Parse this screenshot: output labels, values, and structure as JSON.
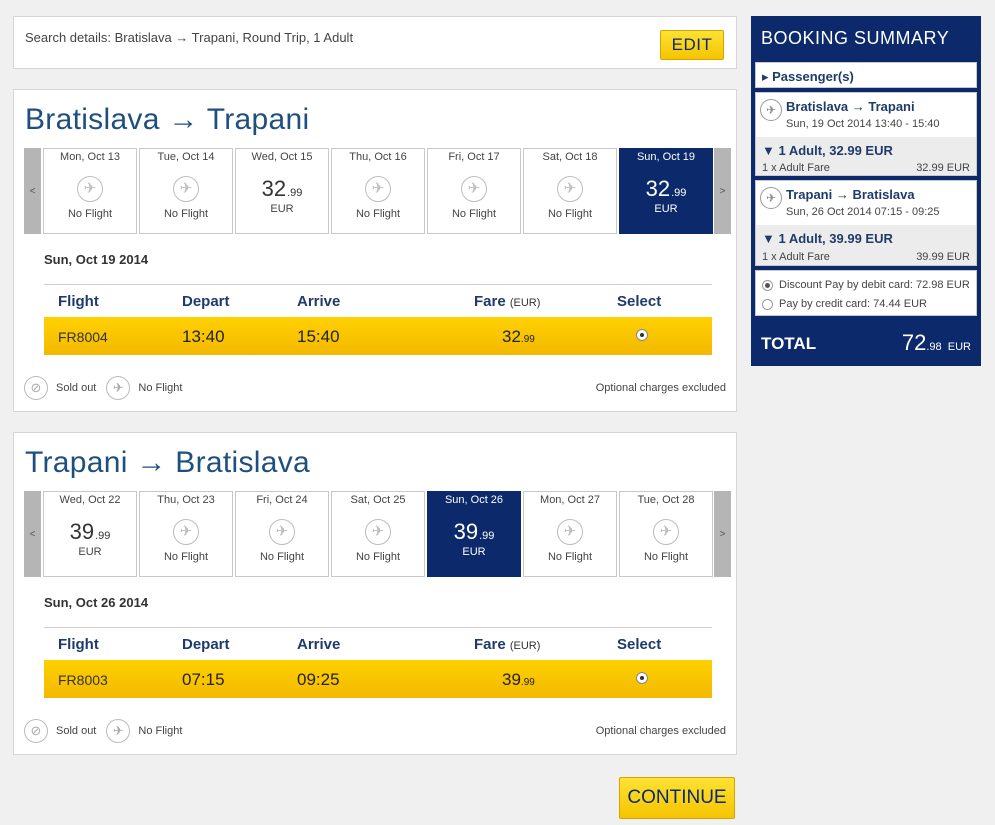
{
  "search": {
    "details": "Search details: Bratislava → Trapani, Round Trip, 1 Adult",
    "edit_label": "EDIT"
  },
  "outbound": {
    "title": "Bratislava → Trapani",
    "dates": [
      {
        "label": "Mon, Oct 13",
        "status": "No Flight"
      },
      {
        "label": "Tue, Oct 14",
        "status": "No Flight"
      },
      {
        "label": "Wed, Oct 15",
        "price": "32",
        "cents": ".99",
        "currency": "EUR"
      },
      {
        "label": "Thu, Oct 16",
        "status": "No Flight"
      },
      {
        "label": "Fri, Oct 17",
        "status": "No Flight"
      },
      {
        "label": "Sat, Oct 18",
        "status": "No Flight"
      },
      {
        "label": "Sun, Oct 19",
        "price": "32",
        "cents": ".99",
        "currency": "EUR",
        "selected": true
      }
    ],
    "selected_date": "Sun, Oct 19 2014",
    "headers": {
      "flight": "Flight",
      "depart": "Depart",
      "arrive": "Arrive",
      "fare": "Fare",
      "fare_unit": "(EUR)",
      "select": "Select"
    },
    "row": {
      "flight_no": "FR8004",
      "depart": "13:40",
      "arrive": "15:40",
      "fare": "32",
      "fare_cents": ".99"
    }
  },
  "inbound": {
    "title": "Trapani → Bratislava",
    "dates": [
      {
        "label": "Wed, Oct 22",
        "price": "39",
        "cents": ".99",
        "currency": "EUR"
      },
      {
        "label": "Thu, Oct 23",
        "status": "No Flight"
      },
      {
        "label": "Fri, Oct 24",
        "status": "No Flight"
      },
      {
        "label": "Sat, Oct 25",
        "status": "No Flight"
      },
      {
        "label": "Sun, Oct 26",
        "price": "39",
        "cents": ".99",
        "currency": "EUR",
        "selected": true
      },
      {
        "label": "Mon, Oct 27",
        "status": "No Flight"
      },
      {
        "label": "Tue, Oct 28",
        "status": "No Flight"
      }
    ],
    "selected_date": "Sun, Oct 26 2014",
    "headers": {
      "flight": "Flight",
      "depart": "Depart",
      "arrive": "Arrive",
      "fare": "Fare",
      "fare_unit": "(EUR)",
      "select": "Select"
    },
    "row": {
      "flight_no": "FR8003",
      "depart": "07:15",
      "arrive": "09:25",
      "fare": "39",
      "fare_cents": ".99"
    }
  },
  "legend": {
    "sold_out": "Sold out",
    "no_flight": "No Flight",
    "optional": "Optional charges excluded"
  },
  "nav": {
    "prev": "<",
    "next": ">"
  },
  "summary": {
    "title": "BOOKING SUMMARY",
    "passengers": "▸ Passenger(s)",
    "out_route": "Bratislava → Trapani",
    "out_time": "Sun, 19 Oct 2014 13:40 - 15:40",
    "out_fare_title": "▼ 1 Adult, 32.99 EUR",
    "out_fare_line": "1 x Adult Fare",
    "out_fare_value": "32.99 EUR",
    "in_route": "Trapani → Bratislava",
    "in_time": "Sun, 26 Oct 2014 07:15 - 09:25",
    "in_fare_title": "▼ 1 Adult, 39.99 EUR",
    "in_fare_line": "1 x Adult Fare",
    "in_fare_value": "39.99 EUR",
    "pay_debit": "Discount Pay by debit card: 72.98 EUR",
    "pay_credit": "Pay by credit card: 74.44 EUR",
    "total_label": "TOTAL",
    "total_int": "72",
    "total_cents": ".98",
    "total_cur": "EUR"
  },
  "continue_label": "CONTINUE",
  "icons": {
    "plane": "✈",
    "sold_out": "⊘",
    "no_flight": "✈"
  },
  "colors": {
    "brand_blue": "#0c2a6b",
    "accent_yellow": "#ffd100",
    "title_blue": "#1f4f7e"
  }
}
